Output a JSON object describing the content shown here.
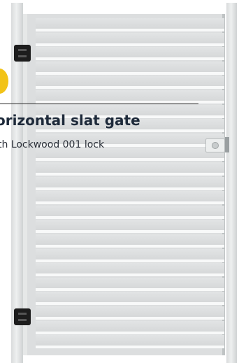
{
  "caption": {
    "title": "orizontal slat gate",
    "subtitle": "th Lockwood 001 lock",
    "badge_color": "#f2c318",
    "divider_color": "#2a2a2a"
  },
  "gate": {
    "slat_count": 23,
    "frame_color": "#dcdedf",
    "gap_color": "#f8f9f9",
    "hinge_color": "#1d1d1d"
  }
}
